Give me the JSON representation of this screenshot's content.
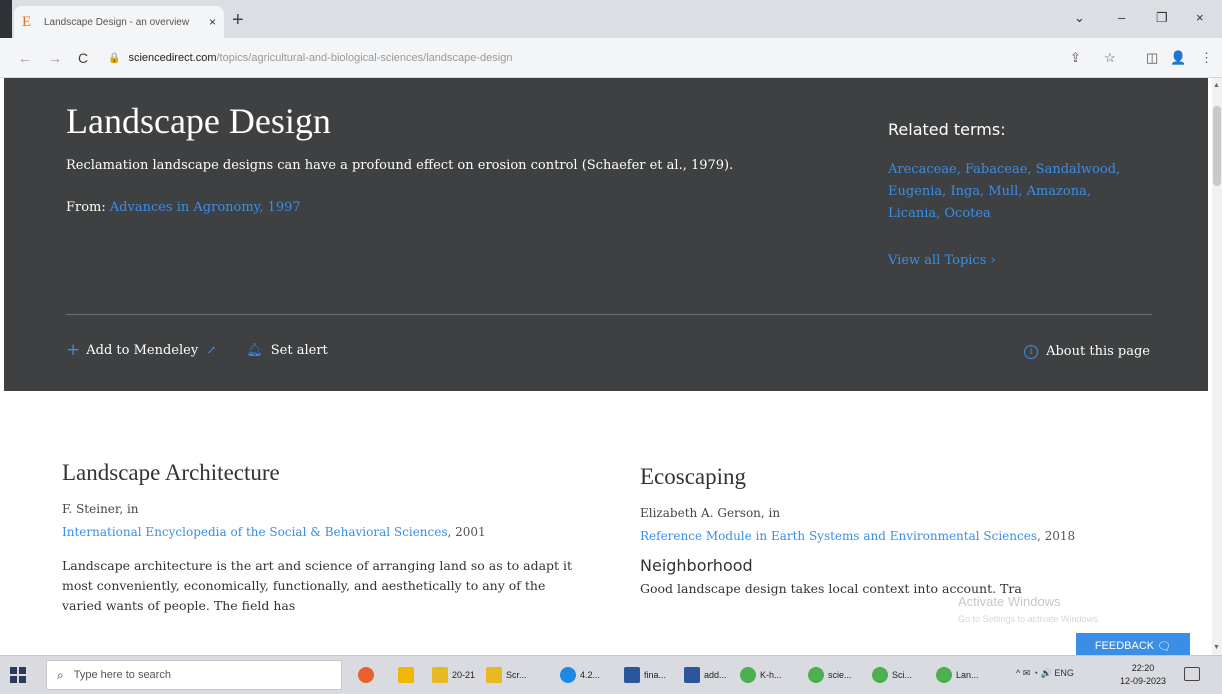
{
  "browser": {
    "tab_title": "Landscape Design - an overview",
    "tab_close": "×",
    "new_tab": "+",
    "favicon": "E",
    "url_domain": "sciencedirect.com",
    "url_path": "/topics/agricultural-and-biological-sciences/landscape-design",
    "controls": {
      "chevron": "⌄",
      "minimize": "–",
      "restore": "❐",
      "close": "×"
    },
    "nav": {
      "back": "←",
      "forward": "→",
      "reload": "C"
    },
    "toolbar_icons": {
      "share": "⇪",
      "bookmark": "☆",
      "sidepanel": "◫",
      "profile": "👤",
      "menu": "⋮"
    }
  },
  "hero": {
    "title": "Landscape Design",
    "definition": "Reclamation landscape designs can have a profound effect on erosion control (Schaefer et al., 1979).",
    "from_label": "From:",
    "from_link": "Advances in Agronomy, 1997",
    "related_heading": "Related terms:",
    "related_terms": [
      "Arecaceae",
      "Fabaceae",
      "Sandalwood",
      "Eugenia",
      "Inga",
      "Mull",
      "Amazona",
      "Licania",
      "Ocotea"
    ],
    "view_all": "View all Topics",
    "add_mendeley": "Add to Mendeley",
    "set_alert": "Set alert",
    "about": "About this page"
  },
  "left": {
    "heading": "Landscape Architecture",
    "author": "F. Steiner, in",
    "source_link": "International Encyclopedia of the Social & Behavioral Sciences",
    "source_year": ", 2001",
    "body": "Landscape architecture is the art and science of arranging land so as to adapt it most conveniently, economically, functionally, and aesthetically to any of the varied wants of people. The field has"
  },
  "right": {
    "heading": "Ecoscaping",
    "author": "Elizabeth A. Gerson, in",
    "source_link": "Reference Module in Earth Systems and Environmental Sciences",
    "source_year": ", 2018",
    "subheading": "Neighborhood",
    "body": "Good landscape design takes local context into account. Tra"
  },
  "overlay": {
    "activate": "Activate Windows",
    "activate_sub": "Go to Settings to activate Windows.",
    "feedback": "FEEDBACK"
  },
  "taskbar": {
    "search_placeholder": "Type here to search",
    "apps": [
      {
        "label": "",
        "color": "#e8602c"
      },
      {
        "label": "",
        "color": "#f2b705"
      },
      {
        "label": "20-21",
        "color": "#e8b923"
      },
      {
        "label": "Scr...",
        "color": "#e8b923"
      },
      {
        "label": "4.2...",
        "color": "#1e88e5"
      },
      {
        "label": "fina...",
        "color": "#2b579a"
      },
      {
        "label": "add...",
        "color": "#2b579a"
      },
      {
        "label": "K-h...",
        "color": "#4caf50"
      },
      {
        "label": "scie...",
        "color": "#4caf50"
      },
      {
        "label": "Sci...",
        "color": "#4caf50"
      },
      {
        "label": "Lan...",
        "color": "#4caf50"
      }
    ],
    "tray": "^ ✉ ◔ 🔊 ENG",
    "time": "22:20",
    "date": "12-09-2023"
  }
}
